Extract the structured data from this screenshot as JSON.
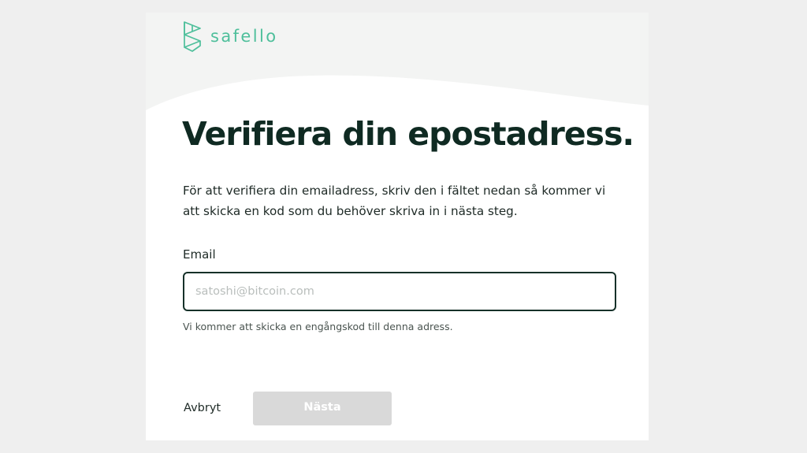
{
  "brand": {
    "name": "safello",
    "color": "#4ebf9b"
  },
  "page": {
    "title": "Verifiera din epostadress.",
    "description": "För att verifiera din emailadress, skriv den i fältet nedan så kommer vi att skicka en kod som du behöver skriva in i nästa steg."
  },
  "form": {
    "email_label": "Email",
    "email_placeholder": "satoshi@bitcoin.com",
    "email_value": "",
    "hint": "Vi kommer att skicka en engångskod till denna adress."
  },
  "actions": {
    "cancel_label": "Avbryt",
    "next_label": "Nästa",
    "next_enabled": false
  },
  "colors": {
    "page_background": "#efefef",
    "header_background": "#f3f4f3",
    "title": "#0f2a22",
    "input_border": "#163129",
    "disabled_button": "#d9d9d9"
  }
}
